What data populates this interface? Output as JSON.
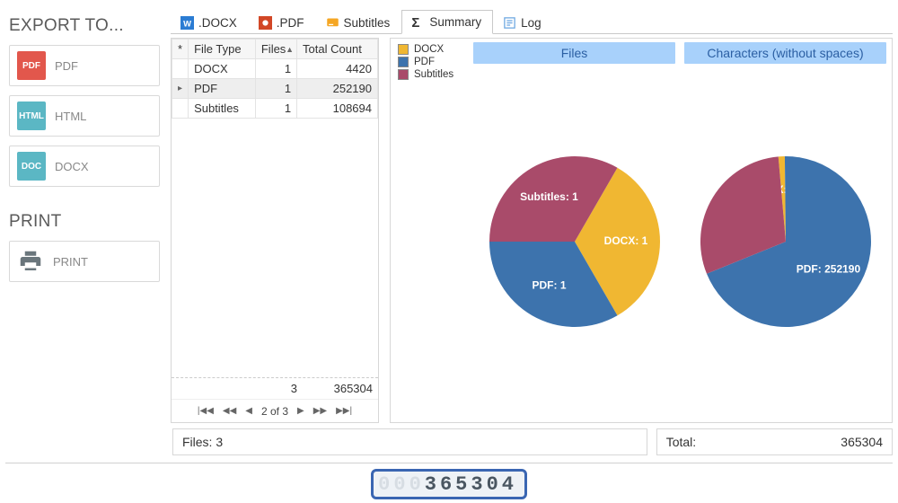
{
  "sidebar": {
    "export_title": "EXPORT TO...",
    "print_title": "PRINT",
    "items": [
      {
        "label": "PDF",
        "icon": "PDF"
      },
      {
        "label": "HTML",
        "icon": "HTML"
      },
      {
        "label": "DOCX",
        "icon": "DOC"
      }
    ],
    "print_btn": "PRINT"
  },
  "tabs": [
    {
      "label": ".DOCX"
    },
    {
      "label": ".PDF"
    },
    {
      "label": "Subtitles"
    },
    {
      "label": "Summary",
      "active": true
    },
    {
      "label": "Log"
    }
  ],
  "grid": {
    "headers": {
      "col0": "*",
      "col1": "File Type",
      "col2": "Files",
      "col3": "Total Count"
    },
    "rows": [
      {
        "type": "DOCX",
        "files": 1,
        "total": 4420
      },
      {
        "type": "PDF",
        "files": 1,
        "total": 252190,
        "selected": true
      },
      {
        "type": "Subtitles",
        "files": 1,
        "total": 108694
      }
    ],
    "footer": {
      "files_sum": 3,
      "total_sum": 365304
    },
    "pager": {
      "text": "2 of 3"
    }
  },
  "legend": [
    {
      "label": "DOCX",
      "color": "#f0b732"
    },
    {
      "label": "PDF",
      "color": "#3d73ad"
    },
    {
      "label": "Subtitles",
      "color": "#a94b6a"
    }
  ],
  "colors": {
    "docx": "#f0b732",
    "pdf": "#3d73ad",
    "subtitles": "#a94b6a"
  },
  "chart_data": [
    {
      "type": "pie",
      "title": "Files",
      "series": [
        {
          "name": "DOCX",
          "value": 1,
          "label": "DOCX: 1"
        },
        {
          "name": "PDF",
          "value": 1,
          "label": "PDF: 1"
        },
        {
          "name": "Subtitles",
          "value": 1,
          "label": "Subtitles: 1"
        }
      ]
    },
    {
      "type": "pie",
      "title": "Characters (without spaces)",
      "series": [
        {
          "name": "DOCX",
          "value": 4420,
          "label": "DOCX: 4420"
        },
        {
          "name": "PDF",
          "value": 252190,
          "label": "PDF: 252190"
        },
        {
          "name": "Subtitles",
          "value": 108694,
          "label": ""
        }
      ]
    }
  ],
  "footer": {
    "files_label": "Files: 3",
    "total_label": "Total:",
    "total_value": "365304"
  },
  "lcd": {
    "pad": "000",
    "value": "365304"
  }
}
